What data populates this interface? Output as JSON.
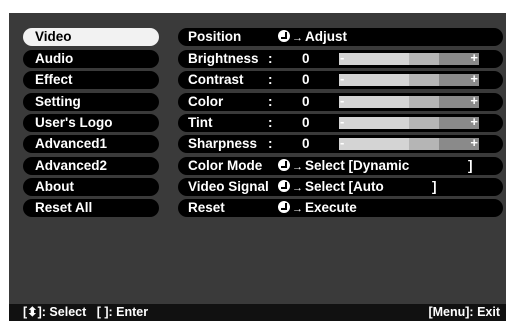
{
  "left_menu": [
    {
      "label": "Video",
      "active": true
    },
    {
      "label": "Audio"
    },
    {
      "label": "Effect"
    },
    {
      "label": "Setting"
    },
    {
      "label": "User's Logo"
    },
    {
      "label": "Advanced1"
    },
    {
      "label": "Advanced2"
    },
    {
      "label": "About"
    },
    {
      "label": "Reset All"
    }
  ],
  "rows": {
    "position": {
      "label": "Position",
      "action": "Adjust"
    },
    "brightness": {
      "label": "Brightness",
      "colon": ":",
      "value": "0",
      "level": 0
    },
    "contrast": {
      "label": "Contrast",
      "colon": ":",
      "value": "0",
      "level": 0
    },
    "color": {
      "label": "Color",
      "colon": ":",
      "value": "0",
      "level": 0
    },
    "tint": {
      "label": "Tint",
      "colon": ":",
      "value": "0",
      "level": 0
    },
    "sharpness": {
      "label": "Sharpness",
      "colon": ":",
      "value": "0",
      "level": 0
    },
    "color_mode": {
      "label": "Color Mode",
      "action": "Select [Dynamic",
      "close": "]"
    },
    "video_signal": {
      "label": "Video Signal",
      "action": "Select [Auto",
      "close": "]"
    },
    "reset": {
      "label": "Reset",
      "action": "Execute"
    }
  },
  "slider": {
    "minus": "-",
    "plus": "+"
  },
  "arrow": "→",
  "status": {
    "select": "[⬍]: Select",
    "enter": "[ ]: Enter",
    "exit": "[Menu]: Exit"
  }
}
